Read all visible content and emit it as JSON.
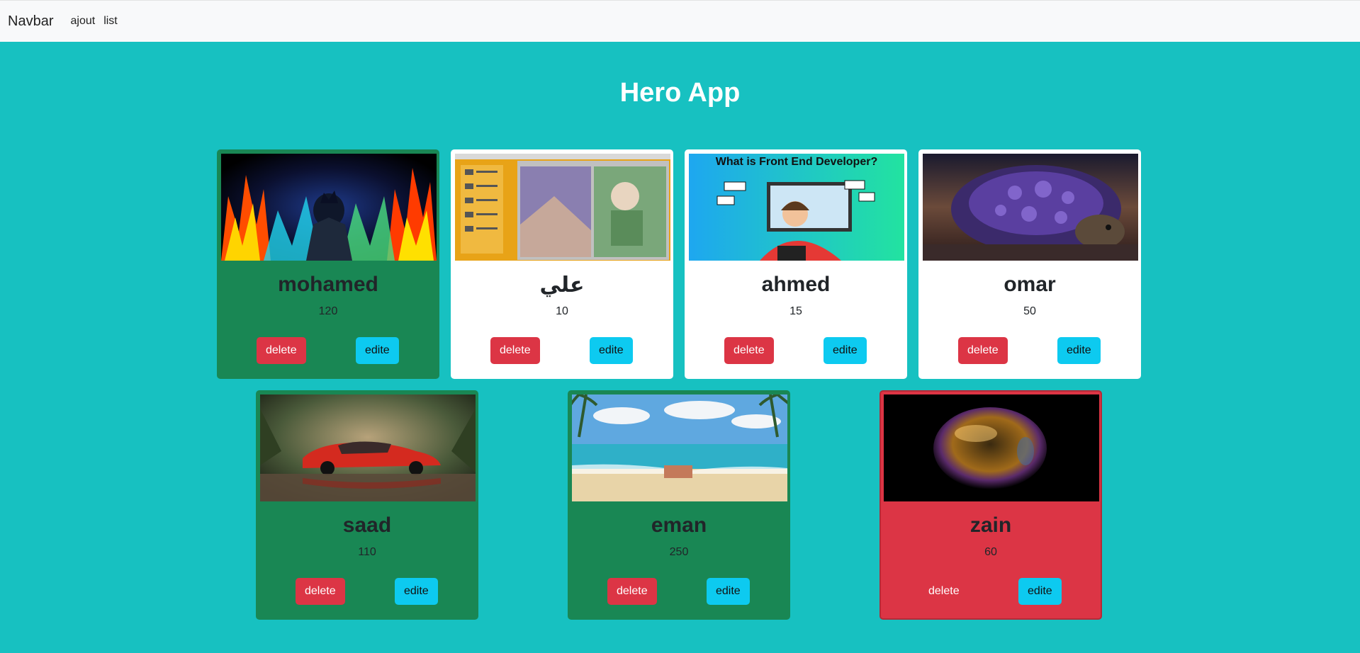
{
  "navbar": {
    "brand": "Navbar",
    "links": [
      "ajout",
      "list"
    ]
  },
  "page": {
    "title": "Hero App"
  },
  "buttons": {
    "delete": "delete",
    "edit": "edite"
  },
  "colors": {
    "background": "#17c1c1",
    "card_green": "#198754",
    "card_white": "#ffffff",
    "card_red": "#dc3545",
    "delete_btn": "#dc3545",
    "edit_btn": "#0dcaf0"
  },
  "heroes": [
    {
      "name": "mohamed",
      "power": "120",
      "theme": "green",
      "image": "dark-warrior-flames"
    },
    {
      "name": "علي",
      "power": "10",
      "theme": "white",
      "image": "anime-retro-desktop"
    },
    {
      "name": "ahmed",
      "power": "15",
      "theme": "white",
      "image": "front-end-developer-illustration",
      "image_text": "What is Front End Developer?"
    },
    {
      "name": "omar",
      "power": "50",
      "theme": "white",
      "image": "cosmic-turtle"
    },
    {
      "name": "saad",
      "power": "110",
      "theme": "green",
      "image": "red-car-forest"
    },
    {
      "name": "eman",
      "power": "250",
      "theme": "green",
      "image": "beach-scene"
    },
    {
      "name": "zain",
      "power": "60",
      "theme": "red",
      "image": "soap-bubble"
    }
  ]
}
